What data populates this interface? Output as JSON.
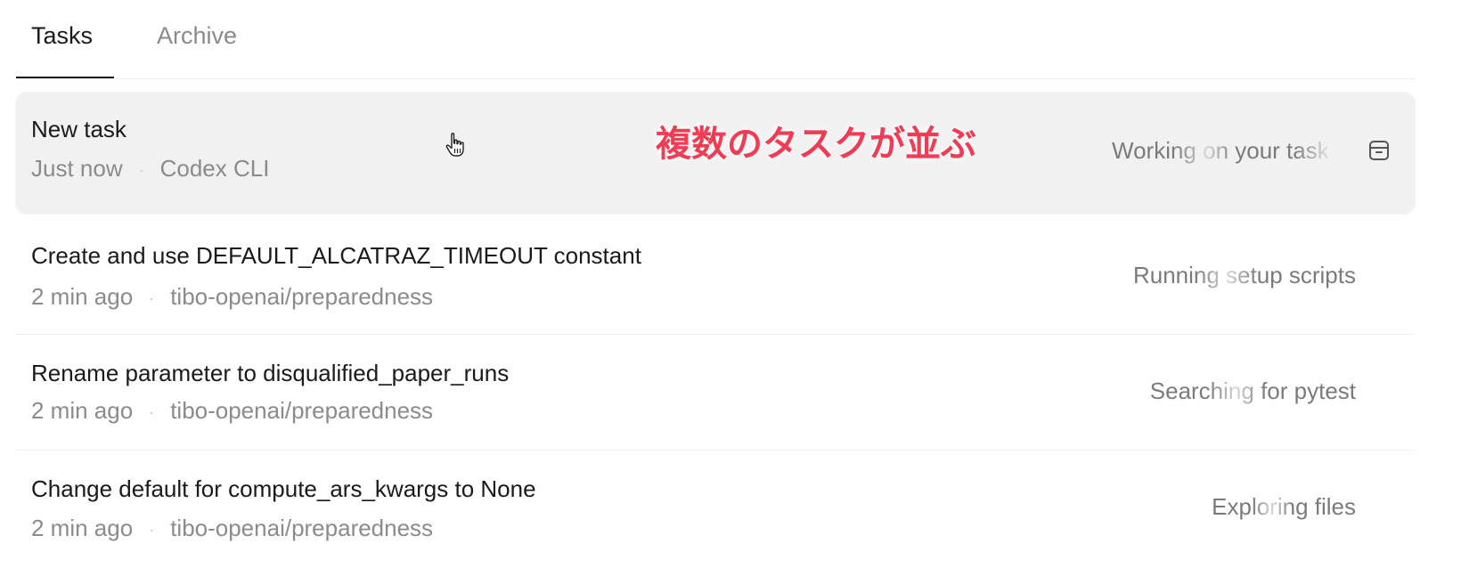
{
  "tabs": [
    {
      "label": "Tasks",
      "active": true
    },
    {
      "label": "Archive",
      "active": false
    }
  ],
  "tasks": [
    {
      "title": "New task",
      "time": "Just now",
      "source": "Codex CLI",
      "status": "Working on your task",
      "highlighted": true
    },
    {
      "title": "Create and use DEFAULT_ALCATRAZ_TIMEOUT constant",
      "time": "2 min ago",
      "source": "tibo-openai/preparedness",
      "status": "Running setup scripts"
    },
    {
      "title": "Rename parameter to disqualified_paper_runs",
      "time": "2 min ago",
      "source": "tibo-openai/preparedness",
      "status": "Searching for pytest"
    },
    {
      "title": "Change default for compute_ars_kwargs to None",
      "time": "2 min ago",
      "source": "tibo-openai/preparedness",
      "status": "Exploring files"
    }
  ],
  "meta_separator": "·",
  "annotation": "複数のタスクが並ぶ",
  "icons": {
    "archive": "archive-box-icon",
    "cursor": "hand-pointer-icon"
  },
  "colors": {
    "annotation": "#f03c54",
    "highlight_row": "#f1f1f1",
    "muted_text": "#8b8b8b"
  }
}
